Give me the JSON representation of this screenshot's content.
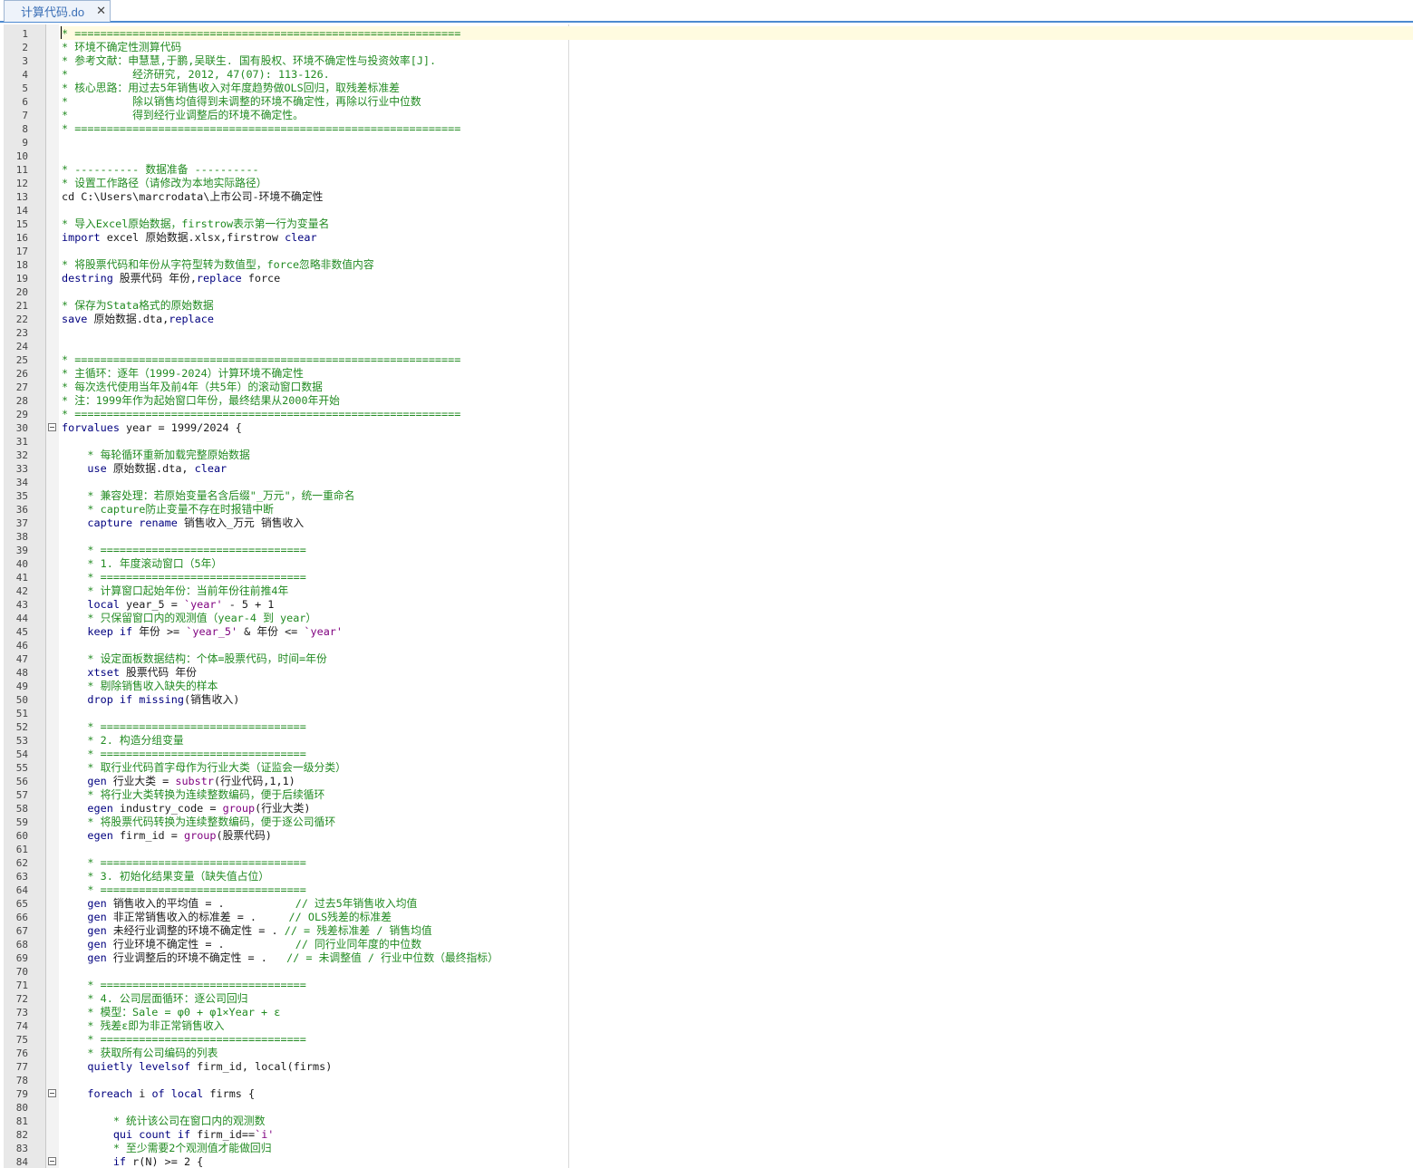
{
  "tab": {
    "label": "计算代码.do",
    "close": "✕"
  },
  "lines": [
    {
      "n": "1",
      "c": true,
      "t": "* ============================================================"
    },
    {
      "n": "2",
      "c": true,
      "t": "* 环境不确定性测算代码"
    },
    {
      "n": "3",
      "c": true,
      "t": "* 参考文献：申慧慧,于鹏,吴联生. 国有股权、环境不确定性与投资效率[J]."
    },
    {
      "n": "4",
      "c": true,
      "t": "*          经济研究, 2012, 47(07): 113-126."
    },
    {
      "n": "5",
      "c": true,
      "t": "* 核心思路：用过去5年销售收入对年度趋势做OLS回归，取残差标准差"
    },
    {
      "n": "6",
      "c": true,
      "t": "*          除以销售均值得到未调整的环境不确定性，再除以行业中位数"
    },
    {
      "n": "7",
      "c": true,
      "t": "*          得到经行业调整后的环境不确定性。"
    },
    {
      "n": "8",
      "c": true,
      "t": "* ============================================================"
    },
    {
      "n": "9",
      "t": ""
    },
    {
      "n": "10",
      "t": ""
    },
    {
      "n": "11",
      "c": true,
      "t": "* ---------- 数据准备 ----------"
    },
    {
      "n": "12",
      "c": true,
      "t": "* 设置工作路径（请修改为本地实际路径）"
    },
    {
      "n": "13",
      "t": "cd C:\\Users\\marcrodata\\上市公司-环境不确定性"
    },
    {
      "n": "14",
      "t": ""
    },
    {
      "n": "15",
      "c": true,
      "t": "* 导入Excel原始数据，firstrow表示第一行为变量名"
    },
    {
      "n": "16",
      "s": [
        {
          "k": "kw",
          "t": "import"
        },
        {
          "t": " excel 原始数据.xlsx,firstrow "
        },
        {
          "k": "kw",
          "t": "clear"
        }
      ]
    },
    {
      "n": "17",
      "t": ""
    },
    {
      "n": "18",
      "c": true,
      "t": "* 将股票代码和年份从字符型转为数值型，force忽略非数值内容"
    },
    {
      "n": "19",
      "s": [
        {
          "k": "kw",
          "t": "destring"
        },
        {
          "t": " 股票代码 年份,"
        },
        {
          "k": "kw",
          "t": "replace"
        },
        {
          "t": " force"
        }
      ]
    },
    {
      "n": "20",
      "t": ""
    },
    {
      "n": "21",
      "c": true,
      "t": "* 保存为Stata格式的原始数据"
    },
    {
      "n": "22",
      "s": [
        {
          "k": "kw",
          "t": "save"
        },
        {
          "t": " 原始数据.dta,"
        },
        {
          "k": "kw",
          "t": "replace"
        }
      ]
    },
    {
      "n": "23",
      "t": ""
    },
    {
      "n": "24",
      "t": ""
    },
    {
      "n": "25",
      "c": true,
      "t": "* ============================================================"
    },
    {
      "n": "26",
      "c": true,
      "t": "* 主循环：逐年（1999-2024）计算环境不确定性"
    },
    {
      "n": "27",
      "c": true,
      "t": "* 每次迭代使用当年及前4年（共5年）的滚动窗口数据"
    },
    {
      "n": "28",
      "c": true,
      "t": "* 注：1999年作为起始窗口年份，最终结果从2000年开始"
    },
    {
      "n": "29",
      "c": true,
      "t": "* ============================================================"
    },
    {
      "n": "30",
      "f": true,
      "s": [
        {
          "k": "kw",
          "t": "forvalues"
        },
        {
          "t": " year = 1999/2024 {"
        }
      ]
    },
    {
      "n": "31",
      "t": ""
    },
    {
      "n": "32",
      "c": true,
      "t": "    * 每轮循环重新加载完整原始数据"
    },
    {
      "n": "33",
      "s": [
        {
          "t": "    "
        },
        {
          "k": "kw",
          "t": "use"
        },
        {
          "t": " 原始数据.dta, "
        },
        {
          "k": "kw",
          "t": "clear"
        }
      ]
    },
    {
      "n": "34",
      "t": ""
    },
    {
      "n": "35",
      "c": true,
      "t": "    * 兼容处理：若原始变量名含后缀\"_万元\"，统一重命名"
    },
    {
      "n": "36",
      "c": true,
      "t": "    * capture防止变量不存在时报错中断"
    },
    {
      "n": "37",
      "s": [
        {
          "t": "    "
        },
        {
          "k": "kw",
          "t": "capture rename"
        },
        {
          "t": " 销售收入_万元 销售收入"
        }
      ]
    },
    {
      "n": "38",
      "t": ""
    },
    {
      "n": "39",
      "c": true,
      "t": "    * ================================"
    },
    {
      "n": "40",
      "c": true,
      "t": "    * 1. 年度滚动窗口（5年）"
    },
    {
      "n": "41",
      "c": true,
      "t": "    * ================================"
    },
    {
      "n": "42",
      "c": true,
      "t": "    * 计算窗口起始年份：当前年份往前推4年"
    },
    {
      "n": "43",
      "s": [
        {
          "t": "    "
        },
        {
          "k": "kw",
          "t": "local"
        },
        {
          "t": " year_5 = "
        },
        {
          "k": "str",
          "t": "`year'"
        },
        {
          "t": " - 5 + 1"
        }
      ]
    },
    {
      "n": "44",
      "c": true,
      "t": "    * 只保留窗口内的观测值（year-4 到 year）"
    },
    {
      "n": "45",
      "s": [
        {
          "t": "    "
        },
        {
          "k": "kw",
          "t": "keep if"
        },
        {
          "t": " 年份 >= "
        },
        {
          "k": "str",
          "t": "`year_5'"
        },
        {
          "t": " & 年份 <= "
        },
        {
          "k": "str",
          "t": "`year'"
        }
      ]
    },
    {
      "n": "46",
      "t": ""
    },
    {
      "n": "47",
      "c": true,
      "t": "    * 设定面板数据结构：个体=股票代码，时间=年份"
    },
    {
      "n": "48",
      "s": [
        {
          "t": "    "
        },
        {
          "k": "kw",
          "t": "xtset"
        },
        {
          "t": " 股票代码 年份"
        }
      ]
    },
    {
      "n": "49",
      "c": true,
      "t": "    * 剔除销售收入缺失的样本"
    },
    {
      "n": "50",
      "s": [
        {
          "t": "    "
        },
        {
          "k": "kw",
          "t": "drop if missing"
        },
        {
          "t": "(销售收入)"
        }
      ]
    },
    {
      "n": "51",
      "t": ""
    },
    {
      "n": "52",
      "c": true,
      "t": "    * ================================"
    },
    {
      "n": "53",
      "c": true,
      "t": "    * 2. 构造分组变量"
    },
    {
      "n": "54",
      "c": true,
      "t": "    * ================================"
    },
    {
      "n": "55",
      "c": true,
      "t": "    * 取行业代码首字母作为行业大类（证监会一级分类）"
    },
    {
      "n": "56",
      "s": [
        {
          "t": "    "
        },
        {
          "k": "kw",
          "t": "gen"
        },
        {
          "t": " 行业大类 = "
        },
        {
          "k": "str",
          "t": "substr"
        },
        {
          "t": "(行业代码,1,1)"
        }
      ]
    },
    {
      "n": "57",
      "c": true,
      "t": "    * 将行业大类转换为连续整数编码，便于后续循环"
    },
    {
      "n": "58",
      "s": [
        {
          "t": "    "
        },
        {
          "k": "kw",
          "t": "egen"
        },
        {
          "t": " industry_code = "
        },
        {
          "k": "str",
          "t": "group"
        },
        {
          "t": "(行业大类)"
        }
      ]
    },
    {
      "n": "59",
      "c": true,
      "t": "    * 将股票代码转换为连续整数编码，便于逐公司循环"
    },
    {
      "n": "60",
      "s": [
        {
          "t": "    "
        },
        {
          "k": "kw",
          "t": "egen"
        },
        {
          "t": " firm_id = "
        },
        {
          "k": "str",
          "t": "group"
        },
        {
          "t": "(股票代码)"
        }
      ]
    },
    {
      "n": "61",
      "t": ""
    },
    {
      "n": "62",
      "c": true,
      "t": "    * ================================"
    },
    {
      "n": "63",
      "c": true,
      "t": "    * 3. 初始化结果变量（缺失值占位）"
    },
    {
      "n": "64",
      "c": true,
      "t": "    * ================================"
    },
    {
      "n": "65",
      "s": [
        {
          "t": "    "
        },
        {
          "k": "kw",
          "t": "gen"
        },
        {
          "t": " 销售收入的平均值 = .           "
        },
        {
          "k": "com",
          "t": "// 过去5年销售收入均值"
        }
      ]
    },
    {
      "n": "66",
      "s": [
        {
          "t": "    "
        },
        {
          "k": "kw",
          "t": "gen"
        },
        {
          "t": " 非正常销售收入的标准差 = .     "
        },
        {
          "k": "com",
          "t": "// OLS残差的标准差"
        }
      ]
    },
    {
      "n": "67",
      "s": [
        {
          "t": "    "
        },
        {
          "k": "kw",
          "t": "gen"
        },
        {
          "t": " 未经行业调整的环境不确定性 = . "
        },
        {
          "k": "com",
          "t": "// = 残差标准差 / 销售均值"
        }
      ]
    },
    {
      "n": "68",
      "s": [
        {
          "t": "    "
        },
        {
          "k": "kw",
          "t": "gen"
        },
        {
          "t": " 行业环境不确定性 = .           "
        },
        {
          "k": "com",
          "t": "// 同行业同年度的中位数"
        }
      ]
    },
    {
      "n": "69",
      "s": [
        {
          "t": "    "
        },
        {
          "k": "kw",
          "t": "gen"
        },
        {
          "t": " 行业调整后的环境不确定性 = .   "
        },
        {
          "k": "com",
          "t": "// = 未调整值 / 行业中位数（最终指标）"
        }
      ]
    },
    {
      "n": "70",
      "t": ""
    },
    {
      "n": "71",
      "c": true,
      "t": "    * ================================"
    },
    {
      "n": "72",
      "c": true,
      "t": "    * 4. 公司层面循环：逐公司回归"
    },
    {
      "n": "73",
      "c": true,
      "t": "    * 模型：Sale = φ0 + φ1×Year + ε"
    },
    {
      "n": "74",
      "c": true,
      "t": "    * 残差ε即为非正常销售收入"
    },
    {
      "n": "75",
      "c": true,
      "t": "    * ================================"
    },
    {
      "n": "76",
      "c": true,
      "t": "    * 获取所有公司编码的列表"
    },
    {
      "n": "77",
      "s": [
        {
          "t": "    "
        },
        {
          "k": "kw",
          "t": "quietly levelsof"
        },
        {
          "t": " firm_id, local(firms)"
        }
      ]
    },
    {
      "n": "78",
      "t": ""
    },
    {
      "n": "79",
      "f": true,
      "s": [
        {
          "t": "    "
        },
        {
          "k": "kw",
          "t": "foreach"
        },
        {
          "t": " i "
        },
        {
          "k": "kw",
          "t": "of local"
        },
        {
          "t": " firms {"
        }
      ]
    },
    {
      "n": "80",
      "t": ""
    },
    {
      "n": "81",
      "c": true,
      "t": "        * 统计该公司在窗口内的观测数"
    },
    {
      "n": "82",
      "s": [
        {
          "t": "        "
        },
        {
          "k": "kw",
          "t": "qui count if"
        },
        {
          "t": " firm_id=="
        },
        {
          "k": "str",
          "t": "`i'"
        }
      ]
    },
    {
      "n": "83",
      "c": true,
      "t": "        * 至少需要2个观测值才能做回归"
    },
    {
      "n": "84",
      "f": true,
      "s": [
        {
          "t": "        "
        },
        {
          "k": "kw",
          "t": "if"
        },
        {
          "t": " r(N) >= 2 {"
        }
      ]
    }
  ]
}
